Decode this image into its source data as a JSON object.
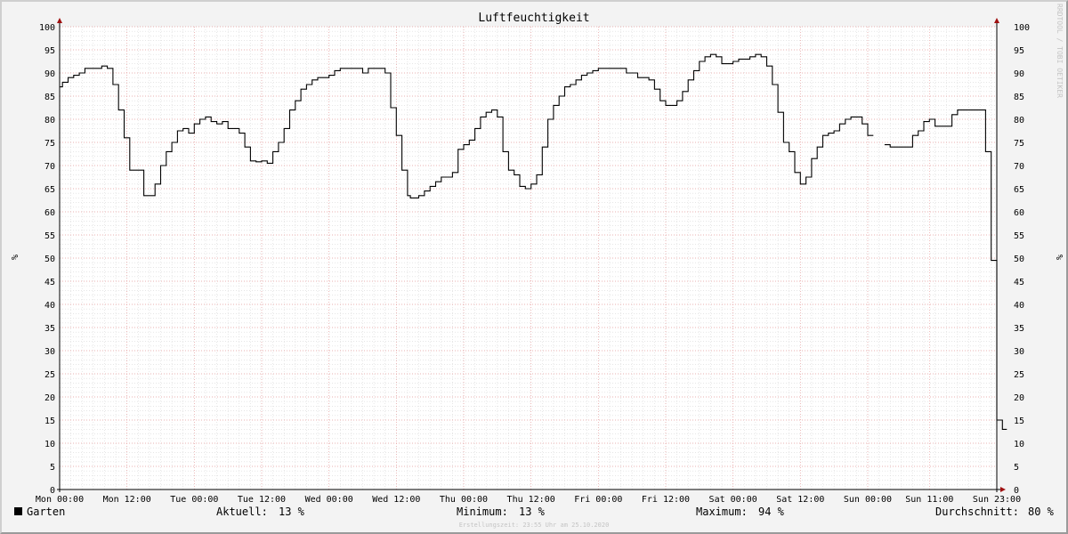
{
  "chart_data": {
    "type": "line",
    "title": "Luftfeuchtigkeit",
    "ylabel": "%",
    "ylabel_right": "%",
    "ylim": [
      0,
      100
    ],
    "yticks": [
      0,
      5,
      10,
      15,
      20,
      25,
      30,
      35,
      40,
      45,
      50,
      55,
      60,
      65,
      70,
      75,
      80,
      85,
      90,
      95,
      100
    ],
    "xrange_hours": [
      0,
      167
    ],
    "xticks": [
      {
        "h": 0,
        "label": "Mon 00:00"
      },
      {
        "h": 12,
        "label": "Mon 12:00"
      },
      {
        "h": 24,
        "label": "Tue 00:00"
      },
      {
        "h": 36,
        "label": "Tue 12:00"
      },
      {
        "h": 48,
        "label": "Wed 00:00"
      },
      {
        "h": 60,
        "label": "Wed 12:00"
      },
      {
        "h": 72,
        "label": "Thu 00:00"
      },
      {
        "h": 84,
        "label": "Thu 12:00"
      },
      {
        "h": 96,
        "label": "Fri 00:00"
      },
      {
        "h": 108,
        "label": "Fri 12:00"
      },
      {
        "h": 120,
        "label": "Sat 00:00"
      },
      {
        "h": 132,
        "label": "Sat 12:00"
      },
      {
        "h": 144,
        "label": "Sun 00:00"
      },
      {
        "h": 155,
        "label": "Sun 11:00"
      },
      {
        "h": 167,
        "label": "Sun 23:00"
      }
    ],
    "grid": true,
    "series": [
      {
        "name": "Garten",
        "color": "#000000",
        "points": [
          [
            0,
            87
          ],
          [
            0.5,
            88
          ],
          [
            1.5,
            89
          ],
          [
            2.5,
            89.5
          ],
          [
            3.5,
            90
          ],
          [
            4.5,
            91
          ],
          [
            5.5,
            91
          ],
          [
            7.5,
            91.5
          ],
          [
            8.5,
            91
          ],
          [
            9.5,
            87.5
          ],
          [
            10.5,
            82
          ],
          [
            11.5,
            76
          ],
          [
            12.5,
            69
          ],
          [
            15,
            63.5
          ],
          [
            17,
            66
          ],
          [
            18,
            70
          ],
          [
            19,
            73
          ],
          [
            20,
            75
          ],
          [
            21,
            77.5
          ],
          [
            22,
            78
          ],
          [
            23,
            77
          ],
          [
            24,
            79
          ],
          [
            25,
            80
          ],
          [
            26,
            80.5
          ],
          [
            27,
            79.5
          ],
          [
            28,
            79
          ],
          [
            29,
            79.5
          ],
          [
            30,
            78
          ],
          [
            31,
            78
          ],
          [
            32,
            77
          ],
          [
            33,
            74
          ],
          [
            34,
            71
          ],
          [
            35,
            70.8
          ],
          [
            36,
            71
          ],
          [
            37,
            70.5
          ],
          [
            38,
            73
          ],
          [
            39,
            75
          ],
          [
            40,
            78
          ],
          [
            41,
            82
          ],
          [
            42,
            84
          ],
          [
            43,
            86.5
          ],
          [
            44,
            87.5
          ],
          [
            45,
            88.5
          ],
          [
            46,
            89
          ],
          [
            48,
            89.5
          ],
          [
            49,
            90.5
          ],
          [
            50,
            91
          ],
          [
            54,
            90
          ],
          [
            55,
            91
          ],
          [
            57,
            91
          ],
          [
            58,
            90
          ],
          [
            59,
            82.5
          ],
          [
            60,
            76.5
          ],
          [
            61,
            69
          ],
          [
            62,
            63.5
          ],
          [
            62.5,
            63
          ],
          [
            64,
            63.5
          ],
          [
            65,
            64.5
          ],
          [
            66,
            65.5
          ],
          [
            67,
            66.5
          ],
          [
            68,
            67.5
          ],
          [
            70,
            68.5
          ],
          [
            71,
            73.5
          ],
          [
            72,
            74.5
          ],
          [
            73,
            75.5
          ],
          [
            74,
            78
          ],
          [
            75,
            80.5
          ],
          [
            76,
            81.5
          ],
          [
            77,
            82
          ],
          [
            78,
            80.5
          ],
          [
            79,
            73
          ],
          [
            80,
            69
          ],
          [
            81,
            68
          ],
          [
            82,
            65.5
          ],
          [
            83,
            65
          ],
          [
            84,
            66
          ],
          [
            85,
            68
          ],
          [
            86,
            74
          ],
          [
            87,
            80
          ],
          [
            88,
            83
          ],
          [
            89,
            85
          ],
          [
            90,
            87
          ],
          [
            91,
            87.5
          ],
          [
            92,
            88.5
          ],
          [
            93,
            89.5
          ],
          [
            94,
            90
          ],
          [
            95,
            90.5
          ],
          [
            96,
            91
          ],
          [
            101,
            90
          ],
          [
            103,
            89
          ],
          [
            105,
            88.5
          ],
          [
            106,
            86.5
          ],
          [
            107,
            84
          ],
          [
            108,
            83
          ],
          [
            110,
            84
          ],
          [
            111,
            86
          ],
          [
            112,
            88.5
          ],
          [
            113,
            90.5
          ],
          [
            114,
            92.5
          ],
          [
            115,
            93.5
          ],
          [
            116,
            94
          ],
          [
            117,
            93.5
          ],
          [
            118,
            92
          ],
          [
            120,
            92.5
          ],
          [
            121,
            93
          ],
          [
            123,
            93.5
          ],
          [
            124,
            94
          ],
          [
            125,
            93.5
          ],
          [
            126,
            91.5
          ],
          [
            127,
            87.5
          ],
          [
            128,
            81.5
          ],
          [
            129,
            75
          ],
          [
            130,
            73
          ],
          [
            131,
            68.5
          ],
          [
            132,
            66
          ],
          [
            133,
            67.5
          ],
          [
            134,
            71.5
          ],
          [
            135,
            74
          ],
          [
            136,
            76.5
          ],
          [
            137,
            77
          ],
          [
            138,
            77.5
          ],
          [
            139,
            79
          ],
          [
            140,
            80
          ],
          [
            141,
            80.5
          ],
          [
            142,
            80.5
          ],
          [
            143,
            79
          ],
          [
            144,
            76.5
          ],
          [
            145,
            76.5
          ],
          null,
          [
            147,
            74.5
          ],
          [
            148,
            74
          ],
          [
            151,
            74
          ],
          [
            152,
            76.5
          ],
          [
            153,
            77.5
          ],
          [
            154,
            79.5
          ],
          [
            155,
            80
          ],
          [
            156,
            78.5
          ],
          [
            158,
            78.5
          ],
          [
            159,
            81
          ],
          [
            160,
            82
          ],
          [
            164,
            82
          ],
          [
            165,
            73
          ],
          [
            166,
            49.5
          ],
          [
            167,
            15
          ],
          [
            168,
            13
          ],
          [
            168.8,
            13
          ]
        ]
      }
    ]
  },
  "legend": {
    "swatch_color": "#000000",
    "series_name": "Garten",
    "current_label": "Aktuell:",
    "current_value": "13 %",
    "min_label": "Minimum:",
    "min_value": "13 %",
    "max_label": "Maximum:",
    "max_value": "94 %",
    "avg_label": "Durchschnitt:",
    "avg_value": "80 %"
  },
  "side_text": "RRDTOOL / TOBI OETIKER",
  "footer": "Erstellungszeit: 23:55 Uhr am 25.10.2020",
  "colors": {
    "background": "#f3f3f3",
    "plot_background": "#ffffff",
    "major_grid": "#e8a0a0",
    "minor_grid": "#d8d8d8",
    "axis_arrow": "#a01010"
  }
}
